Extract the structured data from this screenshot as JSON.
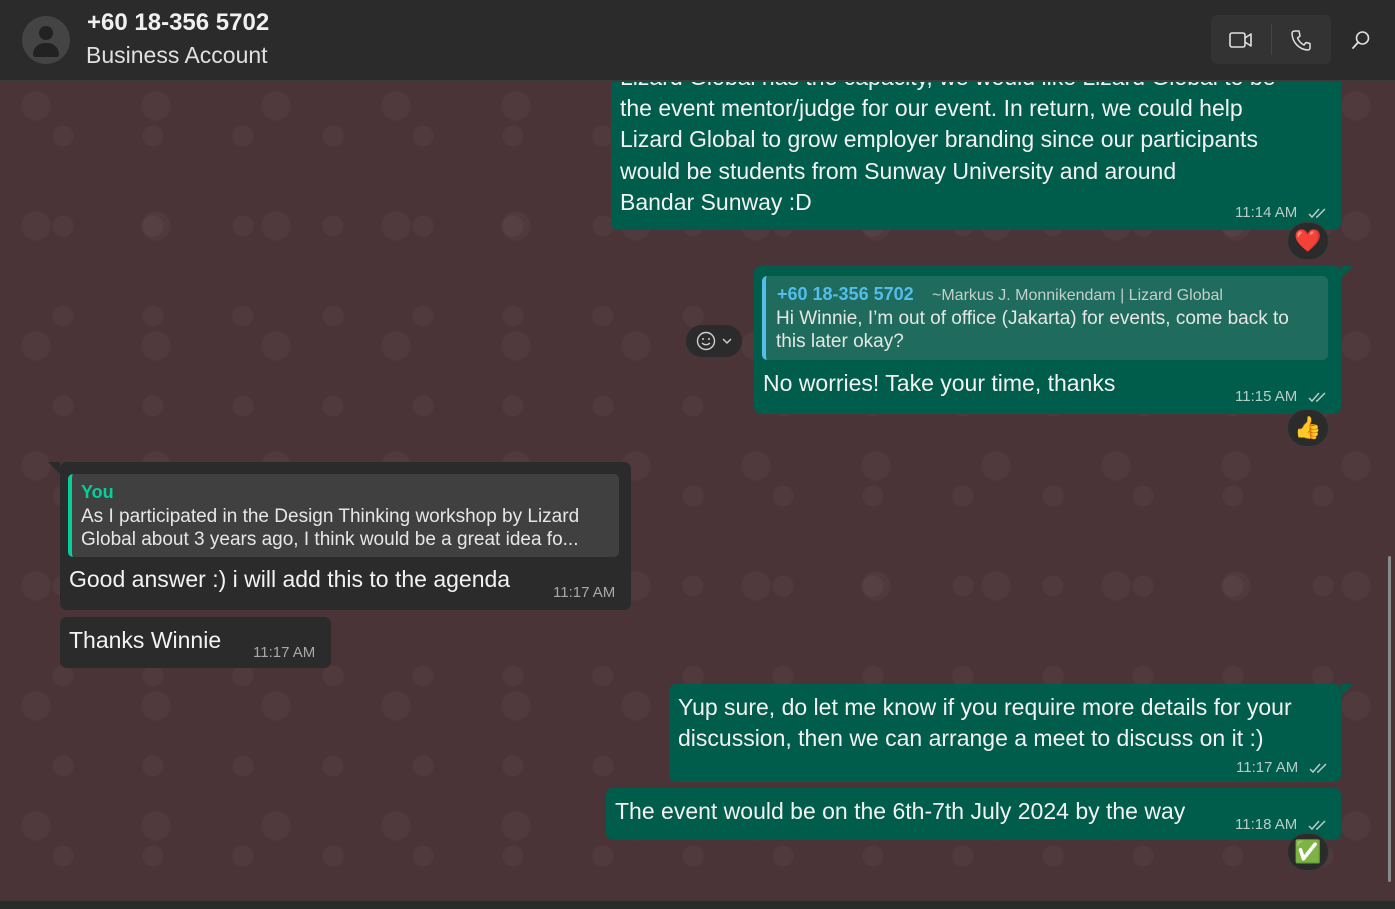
{
  "header": {
    "contact_name": "+60 18-356 5702",
    "contact_subtitle": "Business Account"
  },
  "icons": {
    "video": "video-call-icon",
    "voice": "voice-call-icon",
    "search": "search-icon"
  },
  "messages": [
    {
      "direction": "outgoing",
      "lines": [
        "Lizard Global has the capacity, we would like Lizard Global to be",
        "the event mentor/judge for our event. In return, we could help",
        "Lizard Global to grow employer branding since our participants",
        "would be students from Sunway University and around",
        "Bandar Sunway :D"
      ],
      "time": "11:14 AM",
      "reaction": "❤️"
    },
    {
      "direction": "outgoing",
      "quote": {
        "author": "+60 18-356 5702",
        "author_sub": "~Markus J. Monnikendam | Lizard Global",
        "lines": [
          "Hi Winnie, I’m out of office (Jakarta) for events, come back to",
          "this later okay?"
        ]
      },
      "text": "No worries! Take your time, thanks",
      "time": "11:15 AM",
      "reaction": "👍"
    },
    {
      "direction": "incoming",
      "quote": {
        "author": "You",
        "lines": [
          "As I participated in the Design Thinking workshop by Lizard",
          "Global about 3 years ago, I think would be a great idea fo..."
        ]
      },
      "text": "Good answer :) i will add this to the agenda",
      "time": "11:17 AM"
    },
    {
      "direction": "incoming",
      "text": "Thanks Winnie",
      "time": "11:17 AM"
    },
    {
      "direction": "outgoing",
      "lines": [
        "Yup sure, do let me know if you require more details for your",
        "discussion, then we can arrange a meet to discuss on it :)"
      ],
      "time": "11:17 AM"
    },
    {
      "direction": "outgoing",
      "text": "The event would be on the 6th-7th July 2024 by the way",
      "time": "11:18 AM",
      "reaction": "✅"
    }
  ],
  "colors": {
    "outgoing_bubble": "#005c4b",
    "incoming_bubble": "#2b2b2b",
    "chat_background": "#4a3437",
    "quote_accent_out": "#53bdeb",
    "quote_accent_in": "#06cf9c"
  }
}
